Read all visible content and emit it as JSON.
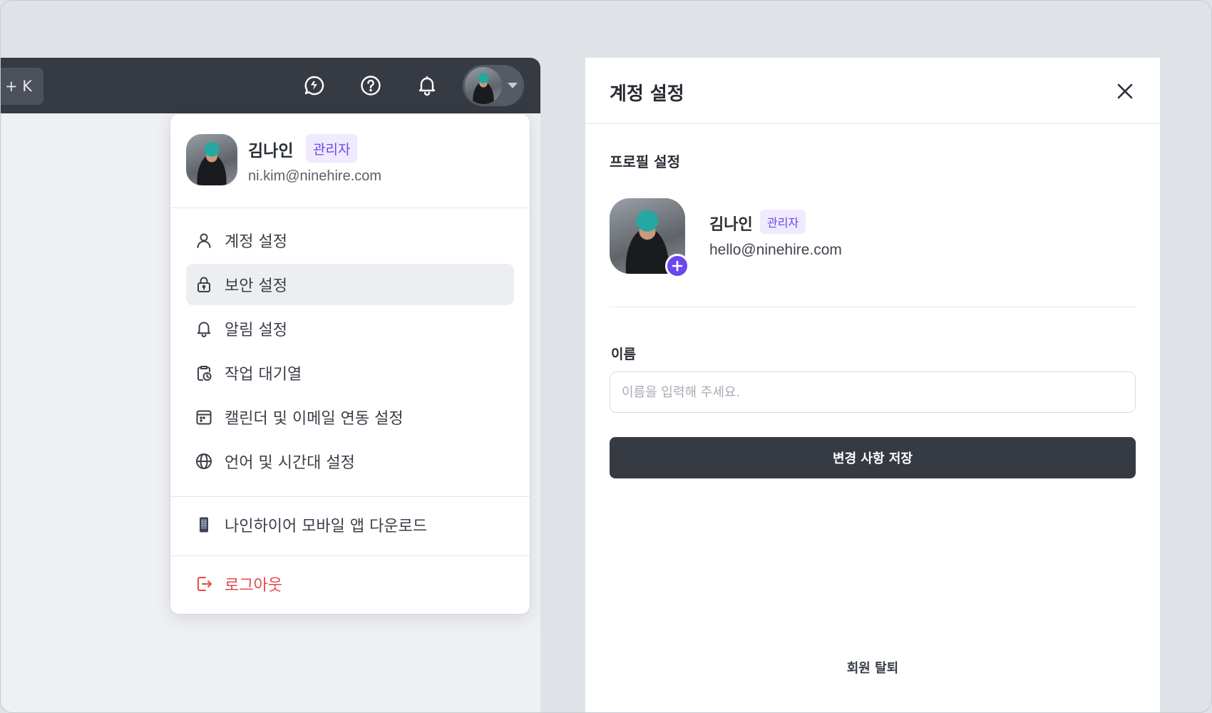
{
  "topbar": {
    "kbd_hint": "+ K",
    "icons": [
      "chat-icon",
      "help-icon",
      "bell-icon"
    ],
    "bg_color": "#363a43"
  },
  "user_menu": {
    "name": "김나인",
    "role_badge": "관리자",
    "email": "ni.kim@ninehire.com",
    "items": [
      {
        "label": "계정 설정",
        "icon": "user-icon"
      },
      {
        "label": "보안 설정",
        "icon": "lock-icon",
        "active": true
      },
      {
        "label": "알림 설정",
        "icon": "bell-icon"
      },
      {
        "label": "작업 대기열",
        "icon": "clipboard-clock-icon"
      },
      {
        "label": "캘린더 및 이메일 연동 설정",
        "icon": "calendar-icon"
      },
      {
        "label": "언어 및 시간대 설정",
        "icon": "globe-icon"
      }
    ],
    "mobile_app": {
      "label": "나인하이어 모바일 앱 다운로드",
      "icon": "phone-icon"
    },
    "logout": {
      "label": "로그아웃",
      "icon": "logout-icon",
      "color": "#e5484d"
    }
  },
  "account_panel": {
    "title": "계정 설정",
    "section_title": "프로필 설정",
    "name": "김나인",
    "role_badge": "관리자",
    "email": "hello@ninehire.com",
    "name_field": {
      "label": "이름",
      "placeholder": "이름을 입력해 주세요.",
      "value": ""
    },
    "save_label": "변경 사항 저장",
    "withdraw_label": "회원 탈퇴"
  },
  "colors": {
    "accent": "#6b47ee",
    "badge_bg": "#efeafe",
    "danger": "#e5484d"
  }
}
